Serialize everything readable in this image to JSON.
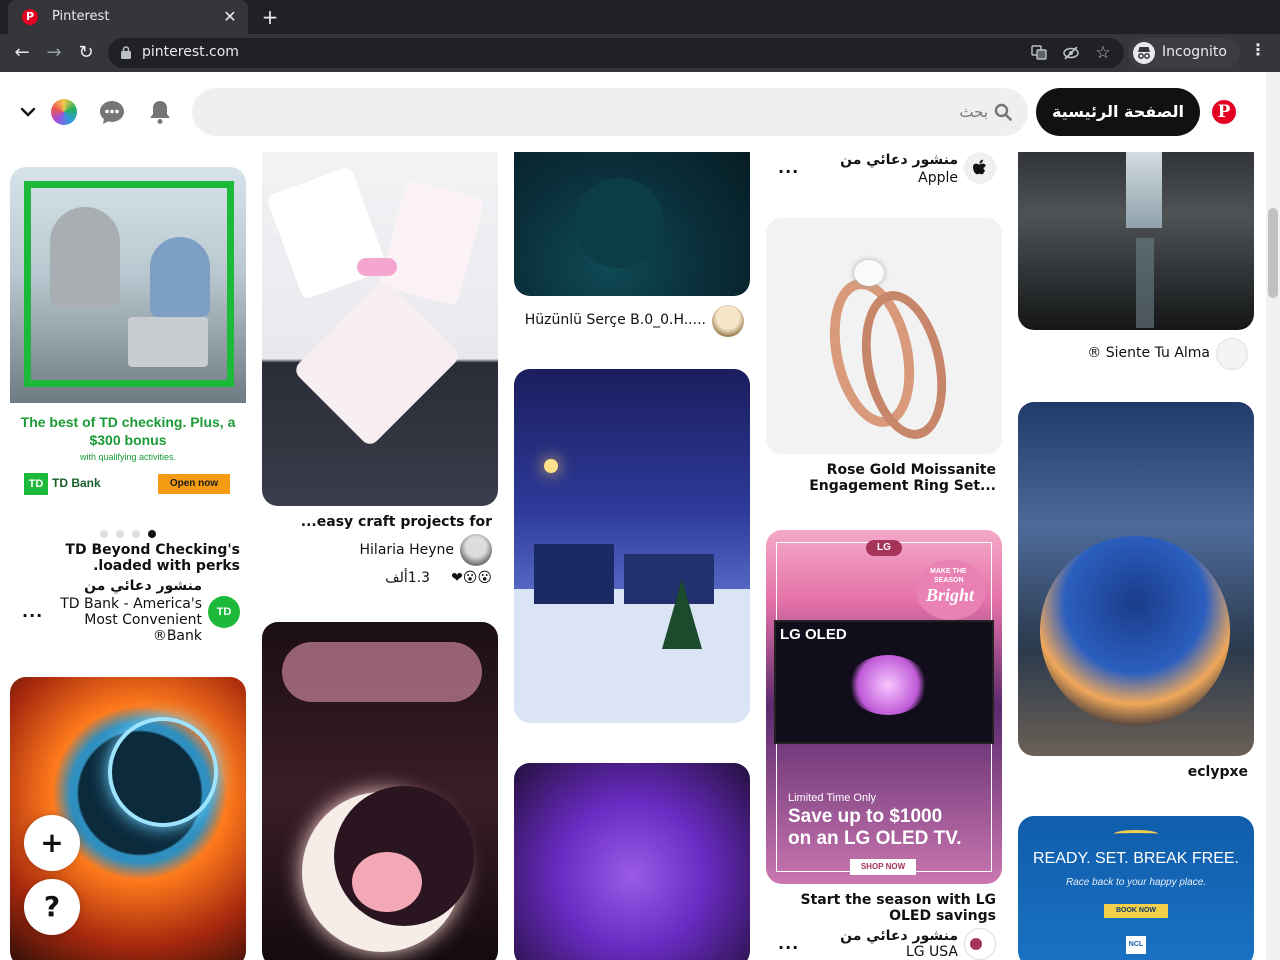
{
  "browser": {
    "tab_title": "Pinterest",
    "tab_close": "✕",
    "new_tab": "+",
    "url": "pinterest.com",
    "incognito_label": "Incognito",
    "back_icon": "←",
    "forward_icon": "→",
    "reload_icon": "↻",
    "menu_icon": "⋮",
    "star_icon": "☆"
  },
  "header": {
    "logo": "P",
    "home_label": "الصفحة الرئيسية",
    "search_placeholder": "بحث"
  },
  "pins": {
    "td": {
      "ad_headline": "The best of TD checking. Plus, a $300 bonus",
      "ad_sub": "with qualifying activities.",
      "ad_brand": "TD Bank",
      "ad_logo": "TD",
      "ad_cta": "Open now",
      "title_line1": "TD Beyond Checking's",
      "title_line2": "loaded with perks.",
      "promoted": "منشور دعائي من",
      "advertiser_line1": "TD Bank - America's",
      "advertiser_line2": "Most Convenient",
      "advertiser_line3": "Bank®",
      "more": "..."
    },
    "craft": {
      "title": "easy craft projects for...",
      "author": "Hilaria Heyne",
      "reactions": "1.3ألف",
      "reaction_icons": "❤😮😮"
    },
    "cat": {
      "author": "Hüzünlü Serçe B.0_0.H....."
    },
    "apple": {
      "promoted": "منشور دعائي من",
      "advertiser": "Apple",
      "more": "..."
    },
    "ring": {
      "title_line1": "Rose Gold Moissanite",
      "title_line2": "Engagement Ring Set..."
    },
    "lg": {
      "brand": "LG",
      "badge_line1": "MAKE THE",
      "badge_line2": "SEASON",
      "badge_line3": "Bright",
      "oled": "LG OLED",
      "limited": "Limited Time Only",
      "save_line1": "Save up to $1000",
      "save_line2": "on an LG OLED TV.",
      "shop": "SHOP NOW",
      "title_line1": "Start the season with LG",
      "title_line2": "OLED savings",
      "promoted": "منشور دعائي من",
      "advertiser": "LG USA",
      "more": "..."
    },
    "waterfall": {
      "author": "Siente Tu Alma ®"
    },
    "sphere": {
      "title": "eclypxe"
    },
    "ncl": {
      "headline": "READY. SET. BREAK FREE.",
      "sub": "Race back to your happy place.",
      "cta": "BOOK NOW",
      "logo": "NCL"
    }
  },
  "fab": {
    "add": "+",
    "help": "?"
  },
  "colors": {
    "brand_red": "#e60023",
    "td_green": "#2db34a",
    "header_black": "#111111"
  }
}
